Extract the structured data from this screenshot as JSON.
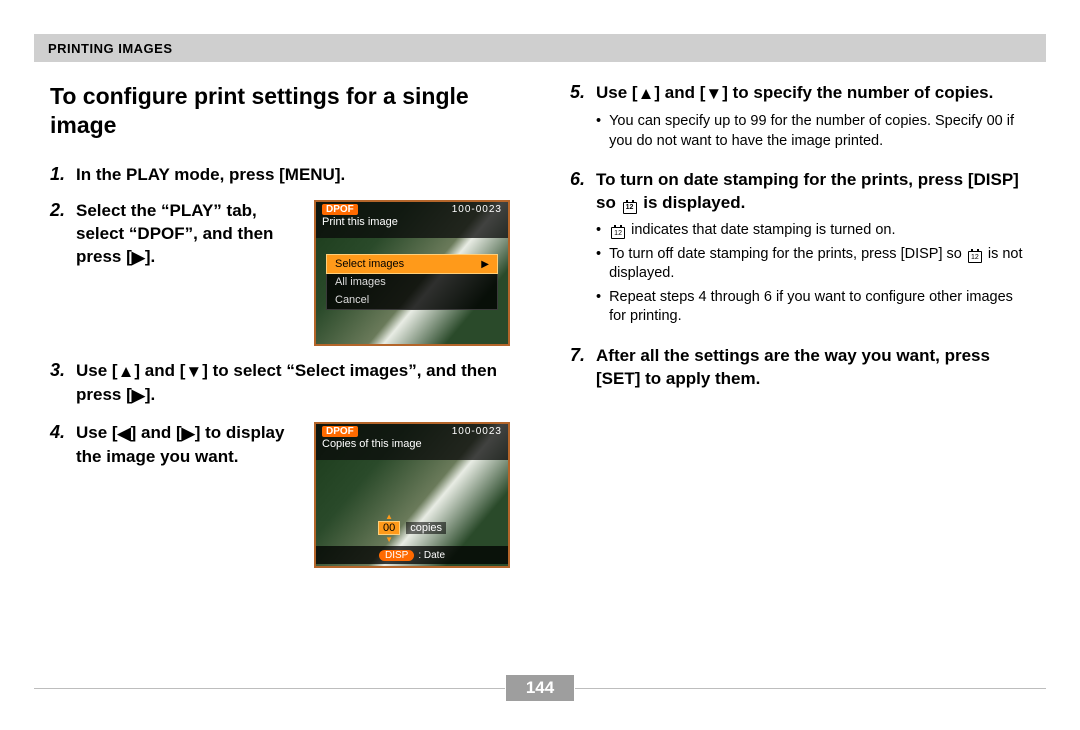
{
  "header": {
    "section": "PRINTING IMAGES"
  },
  "title": "To configure print settings for a single image",
  "left_steps": {
    "s1": {
      "num": "1.",
      "title": "In the PLAY mode, press [MENU]."
    },
    "s2": {
      "num": "2.",
      "title_pre": "Select the “PLAY” tab, select “DPOF”, and then press [",
      "title_post": "]."
    },
    "s3": {
      "num": "3.",
      "title_pre": "Use [",
      "title_mid": "] and [",
      "title_mid2": "] to select “Select images”, and then press [",
      "title_post": "]."
    },
    "s4": {
      "num": "4.",
      "title_pre": "Use [",
      "title_mid": "] and [",
      "title_post": "] to display the image you want."
    }
  },
  "right_steps": {
    "s5": {
      "num": "5.",
      "title_pre": "Use [",
      "title_mid": "] and [",
      "title_post": "] to specify the number of copies.",
      "bullets": [
        "You can specify up to 99 for the number of copies. Specify 00 if you do not want to have the image printed."
      ]
    },
    "s6": {
      "num": "6.",
      "title_pre": "To turn on date stamping for the prints, press [DISP] so ",
      "title_post": " is displayed.",
      "bullet1_pre": "",
      "bullet1_post": " indicates that date stamping is turned on.",
      "bullet2_pre": "To turn off date stamping for the prints, press [DISP] so ",
      "bullet2_post": " is not displayed.",
      "bullet3": "Repeat steps 4 through 6 if you want to configure other images for printing."
    },
    "s7": {
      "num": "7.",
      "title": "After all the settings are the way you want, press [SET] to apply them."
    }
  },
  "shot1": {
    "dpof": "DPOF",
    "folio": "100-0023",
    "subtitle": "Print this image",
    "menu": {
      "i0": "Select images",
      "i1": "All images",
      "i2": "Cancel"
    }
  },
  "shot2": {
    "dpof": "DPOF",
    "folio": "100-0023",
    "subtitle": "Copies of this image",
    "count": "00",
    "count_label": "copies",
    "disp_label": "DISP",
    "disp_text": ": Date"
  },
  "glyph": {
    "up": "▲",
    "down": "▼",
    "left": "◀",
    "right": "▶"
  },
  "page_number": "144"
}
